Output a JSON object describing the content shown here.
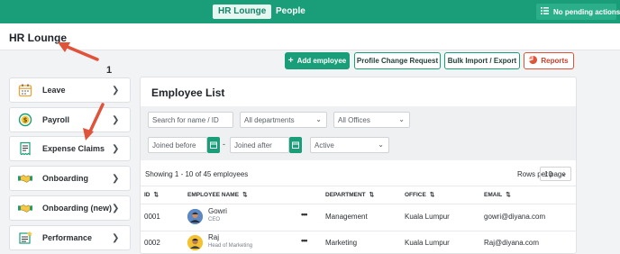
{
  "topbar": {
    "tabs": [
      {
        "label": "HR Lounge",
        "active": true
      },
      {
        "label": "People",
        "active": false
      }
    ],
    "pending_label": "No pending actions"
  },
  "header": {
    "title": "HR Lounge"
  },
  "actions": {
    "add_employee": "Add employee",
    "profile_change": "Profile Change Request",
    "bulk_import": "Bulk Import / Export",
    "reports": "Reports"
  },
  "annotation": {
    "step_number": "1"
  },
  "sidebar": {
    "items": [
      {
        "label": "Leave",
        "icon": "calendar-icon"
      },
      {
        "label": "Payroll",
        "icon": "dollar-coin-icon"
      },
      {
        "label": "Expense Claims",
        "icon": "receipt-icon"
      },
      {
        "label": "Onboarding",
        "icon": "handshake-icon"
      },
      {
        "label": "Onboarding (new)",
        "icon": "handshake-icon"
      },
      {
        "label": "Performance",
        "icon": "performance-board-icon"
      }
    ]
  },
  "employee_list": {
    "title": "Employee List",
    "filters": {
      "search_placeholder": "Search for name / ID",
      "department": "All departments",
      "office": "All Offices",
      "joined_before_placeholder": "Joined before",
      "joined_after_placeholder": "Joined after",
      "date_separator": "-",
      "status": "Active"
    },
    "showing": "Showing 1 - 10 of 45 employees",
    "rows_per_page_label": "Rows per page",
    "rows_per_page": "10",
    "columns": {
      "id": "ID",
      "name": "EMPLOYEE NAME",
      "department": "DEPARTMENT",
      "office": "OFFICE",
      "email": "EMAIL"
    },
    "rows": [
      {
        "id": "0001",
        "name": "Gowri",
        "role": "CEO",
        "department": "Management",
        "office": "Kuala Lumpur",
        "email": "gowri@diyana.com"
      },
      {
        "id": "0002",
        "name": "Raj",
        "role": "Head of Marketing",
        "department": "Marketing",
        "office": "Kuala Lumpur",
        "email": "Raj@diyana.com"
      }
    ]
  },
  "colors": {
    "brand": "#1a9e7a",
    "reports": "#e0523a",
    "arrow": "#e0523a"
  }
}
